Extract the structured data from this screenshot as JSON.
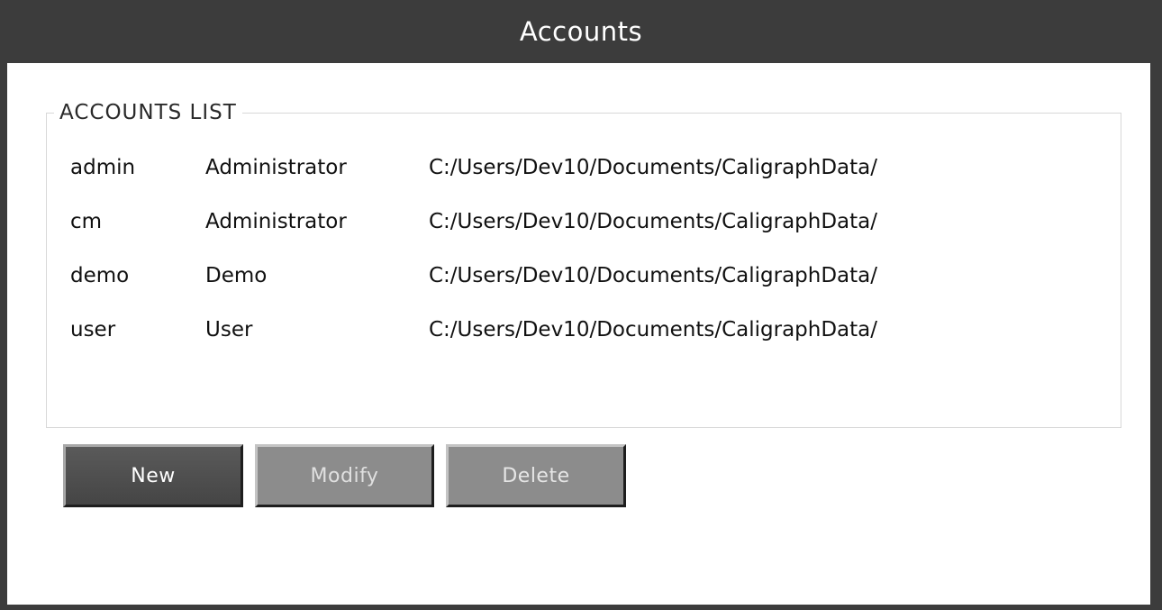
{
  "window": {
    "title": "Accounts"
  },
  "accounts_list": {
    "legend": "ACCOUNTS LIST",
    "rows": [
      {
        "name": "admin",
        "role": "Administrator",
        "path": "C:/Users/Dev10/Documents/CaligraphData/"
      },
      {
        "name": "cm",
        "role": "Administrator",
        "path": "C:/Users/Dev10/Documents/CaligraphData/"
      },
      {
        "name": "demo",
        "role": "Demo",
        "path": "C:/Users/Dev10/Documents/CaligraphData/"
      },
      {
        "name": "user",
        "role": "User",
        "path": "C:/Users/Dev10/Documents/CaligraphData/"
      }
    ]
  },
  "buttons": {
    "new_label": "New",
    "modify_label": "Modify",
    "delete_label": "Delete"
  },
  "colors": {
    "frame": "#3c3c3c",
    "title_text": "#ffffff",
    "button_active": "#4f4f4f",
    "button_disabled": "#8c8c8c"
  }
}
